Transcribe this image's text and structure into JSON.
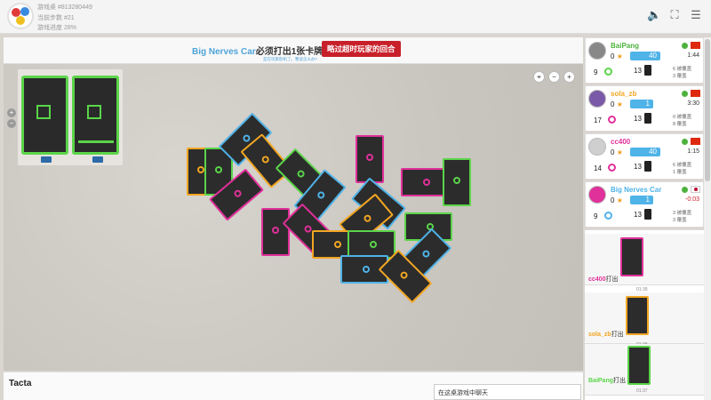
{
  "topbar": {
    "table_label": "游戏桌",
    "table_id": "#813280449",
    "move_label": "当前步数",
    "move_value": "#21",
    "progress_label": "游戏进度",
    "progress_value": "28%"
  },
  "banner": {
    "player_name": "Big Nerves Car",
    "prompt": "必须打出1张卡牌",
    "skip_button": "略过超时玩家的回合",
    "subtext": "是在玩家卧机了。整谈怎么办?"
  },
  "hand": {
    "cards": [
      "hand-card-1",
      "hand-card-2"
    ]
  },
  "board_colors": {
    "green": "#5bd44a",
    "pink": "#e0309a",
    "orange": "#f2a623",
    "blue": "#4fb3e8"
  },
  "players": [
    {
      "name": "BaiPang",
      "name_color": "#4db23c",
      "score": "0",
      "badge": "40",
      "time": "1:44",
      "hand_count": "9",
      "ring_color": "#5bd44a",
      "deck": "13",
      "stat1": "6 被覆盖",
      "stat2": "3 覆盖",
      "flag": "cn"
    },
    {
      "name": "sola_zb",
      "name_color": "#f2a623",
      "score": "0",
      "badge": "1",
      "time": "3:30",
      "hand_count": "17",
      "ring_color": "#e0309a",
      "deck": "13",
      "stat1": "0 被覆盖",
      "stat2": "8 覆盖",
      "flag": "cn"
    },
    {
      "name": "cc400",
      "name_color": "#e0309a",
      "score": "0",
      "badge": "40",
      "time": "1:15",
      "hand_count": "14",
      "ring_color": "#e0309a",
      "deck": "13",
      "stat1": "6 被覆盖",
      "stat2": "1 覆盖",
      "flag": "cn"
    },
    {
      "name": "Big Nerves Car",
      "name_color": "#4fb3e8",
      "score": "0",
      "badge": "1",
      "time": "-0:03",
      "hand_count": "9",
      "ring_color": "#4fb3e8",
      "deck": "13",
      "stat1": "3 被覆盖",
      "stat2": "3 覆盖",
      "flag": "jp"
    }
  ],
  "log": [
    {
      "who": "cc400",
      "action": "打出",
      "time": "01:39",
      "color": "#e0309a"
    },
    {
      "who": "sola_zb",
      "action": "打出",
      "time": "01:38",
      "color": "#f2a623"
    },
    {
      "who": "BaiPang",
      "action": "打出",
      "time": "01:37",
      "color": "#5bd44a"
    }
  ],
  "bottom": {
    "title": "Tacta",
    "chat_placeholder": "在这桌游戏中聊天"
  }
}
